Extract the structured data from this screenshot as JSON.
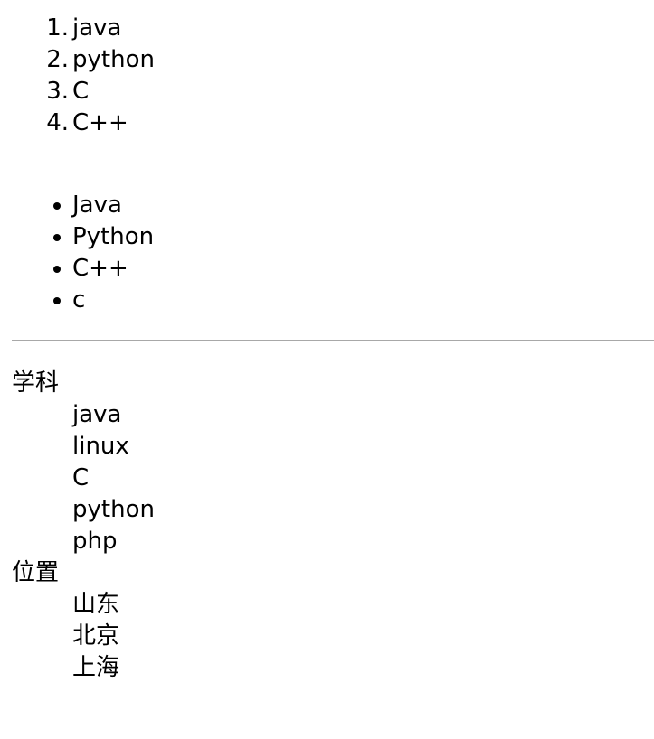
{
  "ordered_list": {
    "items": [
      {
        "marker": "1.",
        "label": "java"
      },
      {
        "marker": "2.",
        "label": "python"
      },
      {
        "marker": "3.",
        "label": "C"
      },
      {
        "marker": "4.",
        "label": "C++"
      }
    ]
  },
  "unordered_list": {
    "items": [
      {
        "label": "Java"
      },
      {
        "label": "Python"
      },
      {
        "label": "C++"
      },
      {
        "label": "c"
      }
    ]
  },
  "definition_list": {
    "groups": [
      {
        "term": "学科",
        "definitions": [
          "java",
          "linux",
          "C",
          "python",
          "php"
        ]
      },
      {
        "term": "位置",
        "definitions": [
          "山东",
          "北京",
          "上海"
        ]
      }
    ]
  }
}
